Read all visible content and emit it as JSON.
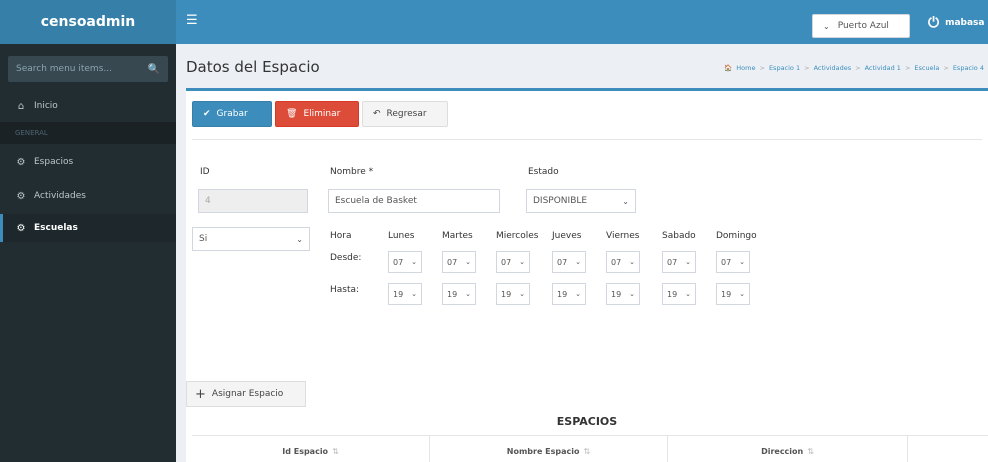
{
  "app": {
    "brand": "censoadmin",
    "menu_icon": "hamburger-icon"
  },
  "topbar": {
    "location": "Puerto Azul",
    "user": "mabasa",
    "power_icon": "power-icon"
  },
  "sidebar": {
    "search_placeholder": "Search menu items...",
    "items": [
      {
        "label": "Inicio",
        "icon": "home-icon"
      },
      {
        "label": "GENERAL"
      },
      {
        "label": "Espacios",
        "icon": "gear-icon"
      },
      {
        "label": "Actividades",
        "icon": "gear-icon"
      },
      {
        "label": "Escuelas",
        "icon": "gear-icon",
        "active": true
      }
    ]
  },
  "header": {
    "title": "Datos del Espacio",
    "breadcrumb": [
      "Home",
      "Espacio 1",
      "Actividades",
      "Actividad 1",
      "Escuela",
      "Espacio 4"
    ]
  },
  "toolbar": {
    "grabar": "Grabar",
    "eliminar": "Eliminar",
    "regresar": "Regresar"
  },
  "form": {
    "id_label": "ID",
    "id_value": "4",
    "nombre_label": "Nombre *",
    "nombre_value": "Escuela de Basket",
    "estado_label": "Estado",
    "estado_value": "DISPONIBLE",
    "si_value": "Si",
    "hora_label": "Hora",
    "desde_label": "Desde:",
    "hasta_label": "Hasta:",
    "days": [
      "Lunes",
      "Martes",
      "Miercoles",
      "Jueves",
      "Viernes",
      "Sabado",
      "Domingo"
    ],
    "desde_value": "07",
    "hasta_value": "19"
  },
  "assign": {
    "label": "Asignar Espacio"
  },
  "table": {
    "title": "ESPACIOS",
    "columns": [
      "Id Espacio",
      "Nombre Espacio",
      "Direccion"
    ]
  }
}
